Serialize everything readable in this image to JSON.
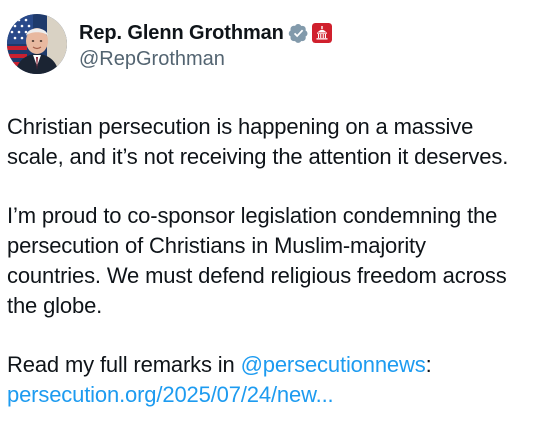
{
  "author": {
    "display_name": "Rep. Glenn Grothman",
    "handle": "@RepGrothman",
    "verified_icon": "verified-badge-icon",
    "affiliation_icon": "us-house-affiliate-icon",
    "verified_color": "#829aab",
    "affiliation_color": "#d0202d"
  },
  "tweet": {
    "paragraph1": {
      "line1": "Christian persecution is happening on a massive",
      "line2": "scale, and it’s not receiving the attention it deserves."
    },
    "paragraph2": {
      "line1": "I’m proud to co-sponsor legislation condemning the",
      "line2": "persecution of Christians in Muslim-majority",
      "line3": "countries. We must defend religious freedom across",
      "line4": "the globe."
    },
    "paragraph3": {
      "prefix": "Read my full remarks in ",
      "mention": "@persecutionnews",
      "suffix": ":",
      "url": "persecution.org/2025/07/24/new..."
    }
  },
  "colors": {
    "text": "#0f1419",
    "secondary": "#536471",
    "link": "#1d9bf0"
  }
}
